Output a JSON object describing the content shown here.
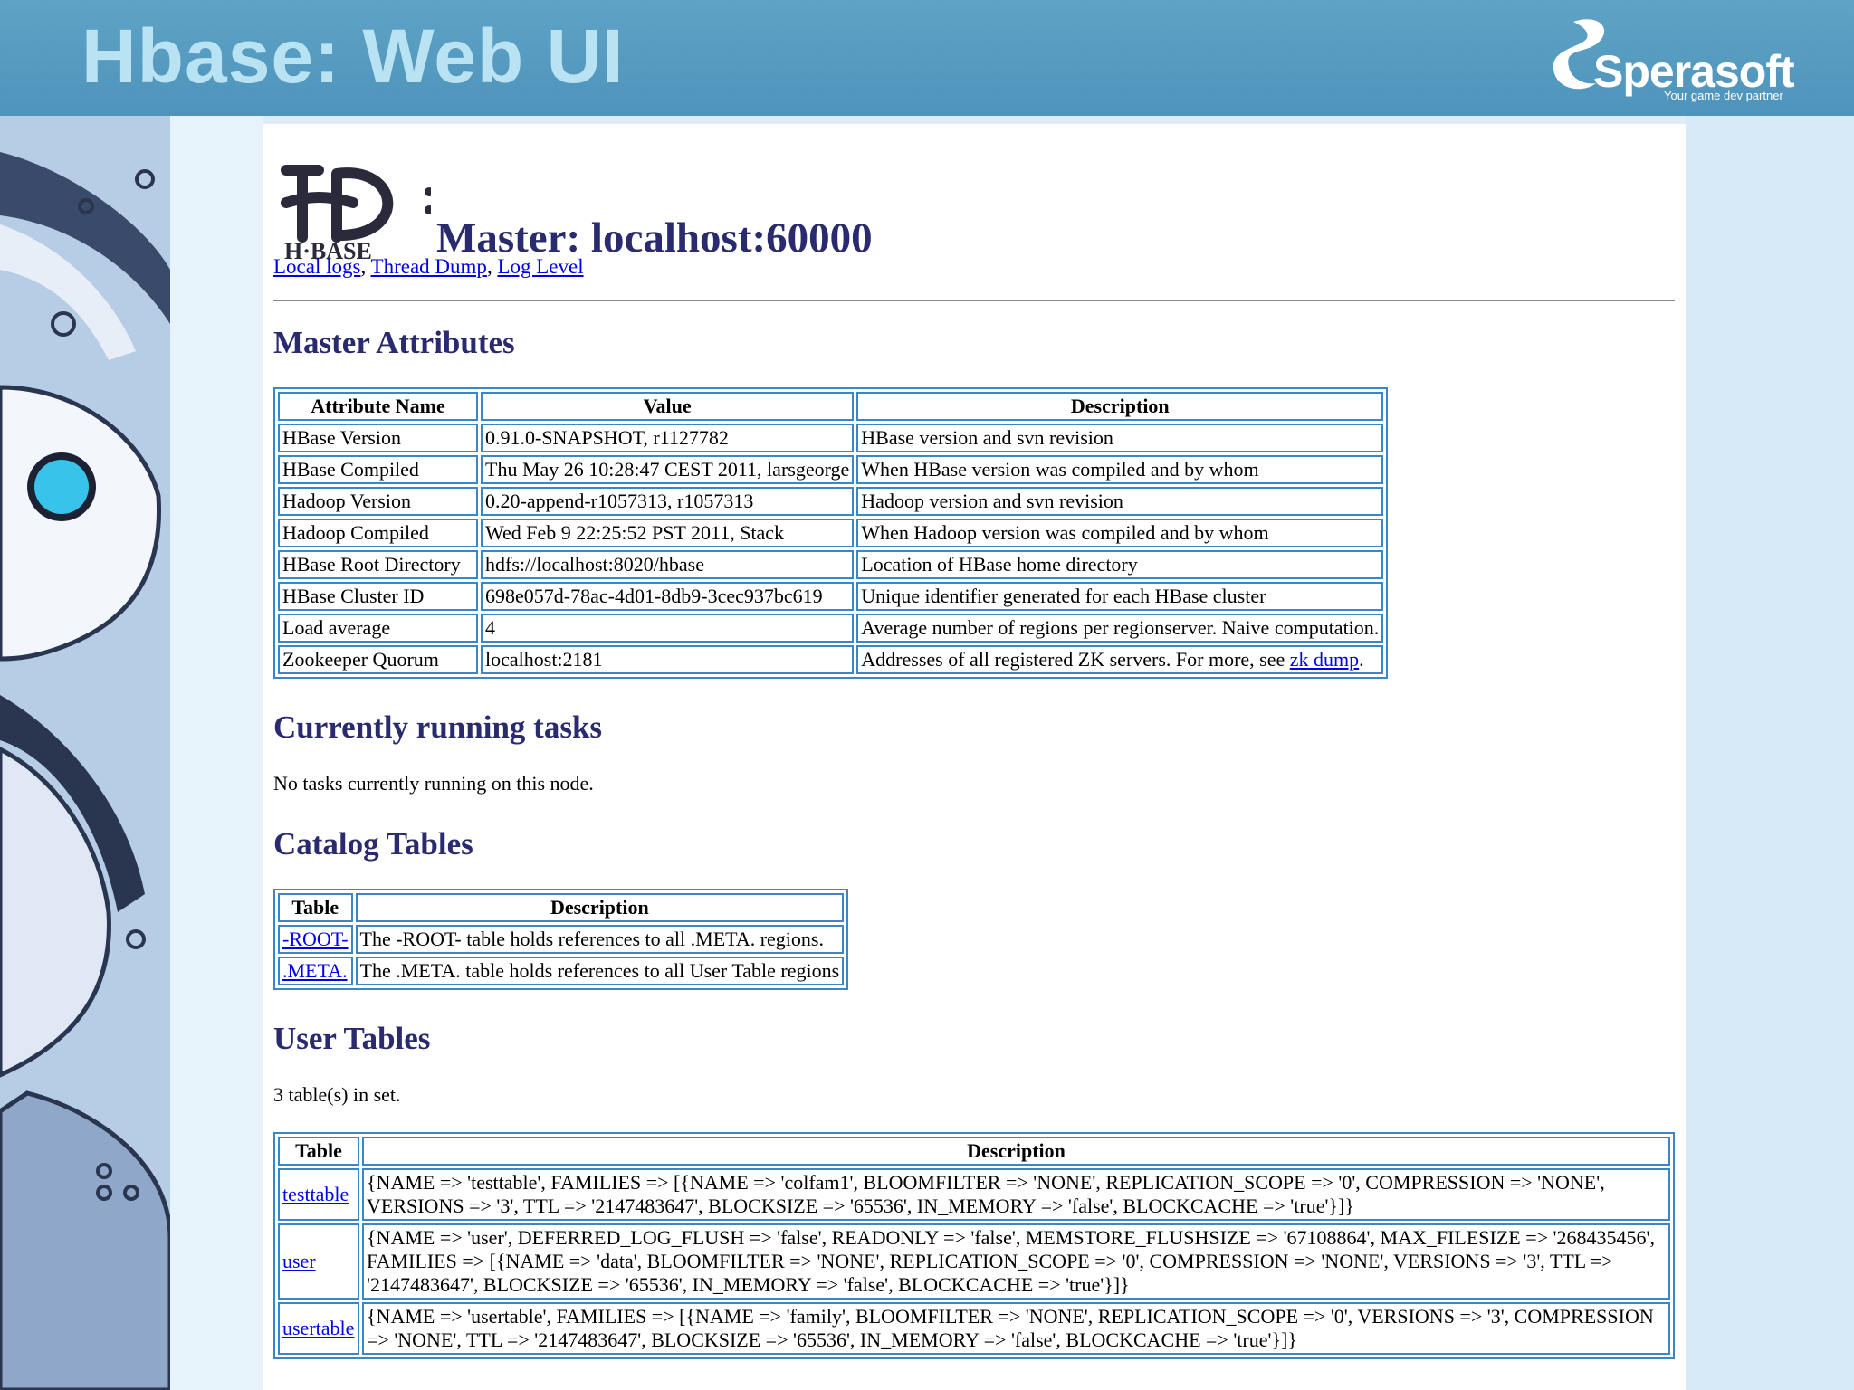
{
  "slide": {
    "title": "Hbase: Web UI",
    "brand_name": "Sperasoft",
    "brand_tagline": "Your game dev partner"
  },
  "logo_text": "H·BASE",
  "master": {
    "title": "Master: localhost:60000",
    "links": [
      "Local logs",
      "Thread Dump",
      "Log Level"
    ]
  },
  "master_attributes": {
    "heading": "Master Attributes",
    "columns": [
      "Attribute Name",
      "Value",
      "Description"
    ],
    "rows": [
      {
        "name": "HBase Version",
        "value": "0.91.0-SNAPSHOT, r1127782",
        "desc": "HBase version and svn revision"
      },
      {
        "name": "HBase Compiled",
        "value": "Thu May 26 10:28:47 CEST 2011, larsgeorge",
        "desc": "When HBase version was compiled and by whom"
      },
      {
        "name": "Hadoop Version",
        "value": "0.20-append-r1057313, r1057313",
        "desc": "Hadoop version and svn revision"
      },
      {
        "name": "Hadoop Compiled",
        "value": "Wed Feb 9 22:25:52 PST 2011, Stack",
        "desc": "When Hadoop version was compiled and by whom"
      },
      {
        "name": "HBase Root Directory",
        "value": "hdfs://localhost:8020/hbase",
        "desc": "Location of HBase home directory"
      },
      {
        "name": "HBase Cluster ID",
        "value": "698e057d-78ac-4d01-8db9-3cec937bc619",
        "desc": "Unique identifier generated for each HBase cluster"
      },
      {
        "name": "Load average",
        "value": "4",
        "desc": "Average number of regions per regionserver. Naive computation."
      },
      {
        "name": "Zookeeper Quorum",
        "value": "localhost:2181",
        "desc": "Addresses of all registered ZK servers. For more, see ",
        "link": "zk dump",
        "desc_end": "."
      }
    ]
  },
  "running_tasks": {
    "heading": "Currently running tasks",
    "text": "No tasks currently running on this node."
  },
  "catalog_tables": {
    "heading": "Catalog Tables",
    "columns": [
      "Table",
      "Description"
    ],
    "rows": [
      {
        "table": "-ROOT-",
        "desc": "The -ROOT- table holds references to all .META. regions."
      },
      {
        "table": ".META.",
        "desc": "The .META. table holds references to all User Table regions"
      }
    ]
  },
  "user_tables": {
    "heading": "User Tables",
    "count_text": "3 table(s) in set.",
    "columns": [
      "Table",
      "Description"
    ],
    "rows": [
      {
        "table": "testtable",
        "desc": "{NAME => 'testtable', FAMILIES => [{NAME => 'colfam1', BLOOMFILTER => 'NONE', REPLICATION_SCOPE => '0', COMPRESSION => 'NONE', VERSIONS => '3', TTL => '2147483647', BLOCKSIZE => '65536', IN_MEMORY => 'false', BLOCKCACHE => 'true'}]}"
      },
      {
        "table": "user",
        "desc": "{NAME => 'user', DEFERRED_LOG_FLUSH => 'false', READONLY => 'false', MEMSTORE_FLUSHSIZE => '67108864', MAX_FILESIZE => '268435456', FAMILIES => [{NAME => 'data', BLOOMFILTER => 'NONE', REPLICATION_SCOPE => '0', COMPRESSION => 'NONE', VERSIONS => '3', TTL => '2147483647', BLOCKSIZE => '65536', IN_MEMORY => 'false', BLOCKCACHE => 'true'}]}"
      },
      {
        "table": "usertable",
        "desc": "{NAME => 'usertable', FAMILIES => [{NAME => 'family', BLOOMFILTER => 'NONE', REPLICATION_SCOPE => '0', VERSIONS => '3', COMPRESSION => 'NONE', TTL => '2147483647', BLOCKSIZE => '65536', IN_MEMORY => 'false', BLOCKCACHE => 'true'}]}"
      }
    ]
  },
  "colors": {
    "header_band": "#4e93bb",
    "title_text": "#b9e3f3",
    "heading": "#2a2a6e",
    "table_border": "#3a86c8",
    "link": "#0000ee"
  }
}
